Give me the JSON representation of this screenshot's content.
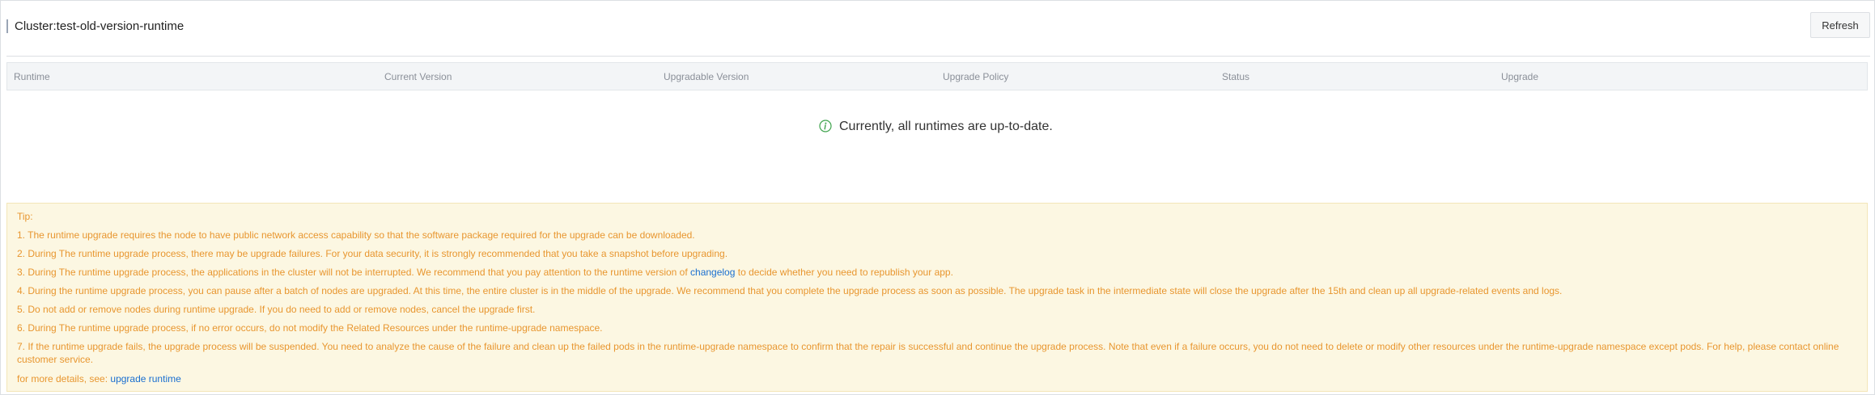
{
  "header": {
    "title": "Cluster:test-old-version-runtime",
    "refresh_label": "Refresh"
  },
  "table": {
    "columns": [
      "Runtime",
      "Current Version",
      "Upgradable Version",
      "Upgrade Policy",
      "Status",
      "Upgrade"
    ],
    "empty_message": "Currently, all runtimes are up-to-date."
  },
  "tips": {
    "heading": "Tip:",
    "line1": "1. The runtime upgrade requires the node to have public network access capability so that the software package required for the upgrade can be downloaded.",
    "line2": "2. During The runtime upgrade process, there may be upgrade failures. For your data security, it is strongly recommended that you take a snapshot before upgrading.",
    "line3_before": "3. During The runtime upgrade process, the applications in the cluster will not be interrupted. We recommend that you pay attention to the runtime version of ",
    "line3_link": "changelog",
    "line3_after": " to decide whether you need to republish your app.",
    "line4": "4. During the runtime upgrade process, you can pause after a batch of nodes are upgraded. At this time, the entire cluster is in the middle of the upgrade. We recommend that you complete the upgrade process as soon as possible. The upgrade task in the intermediate state will close the upgrade after the 15th and clean up all upgrade-related events and logs.",
    "line5": "5. Do not add or remove nodes during runtime upgrade. If you do need to add or remove nodes, cancel the upgrade first.",
    "line6": "6. During The runtime upgrade process, if no error occurs, do not modify the Related Resources under the runtime-upgrade namespace.",
    "line7": "7. If the runtime upgrade fails, the upgrade process will be suspended. You need to analyze the cause of the failure and clean up the failed pods in the runtime-upgrade namespace to confirm that the repair is successful and continue the upgrade process. Note that even if a failure occurs, you do not need to delete or modify other resources under the runtime-upgrade namespace except pods. For help, please contact online customer service.",
    "more_prefix": "for more details, see: ",
    "more_link": "upgrade runtime"
  },
  "colors": {
    "tip_text": "#e8962f",
    "link": "#1a6fd0",
    "info_icon": "#3fa34d"
  },
  "icons": {
    "empty_state": "info-circle-icon"
  }
}
